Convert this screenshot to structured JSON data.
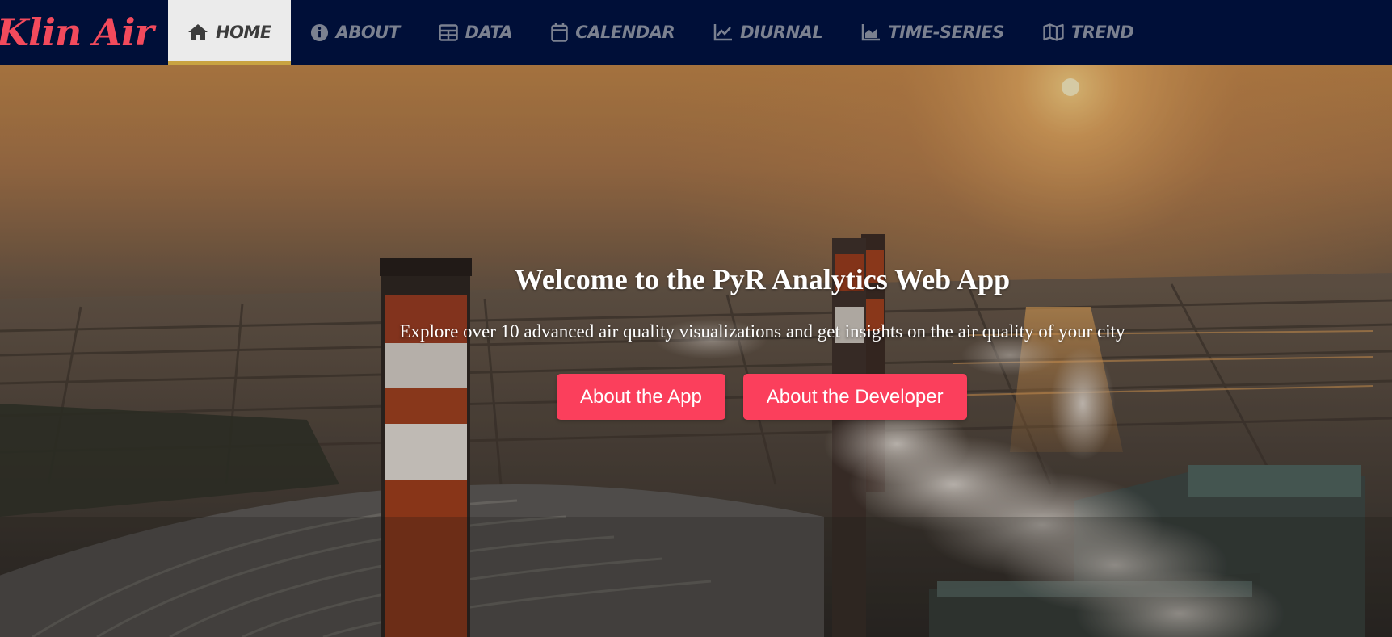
{
  "brand": {
    "name": "Klin Air",
    "color": "#f24a5c"
  },
  "nav": {
    "background": "#000f38",
    "active_index": 0,
    "items": [
      {
        "label": "HOME",
        "icon": "home-icon"
      },
      {
        "label": "ABOUT",
        "icon": "info-circle-icon"
      },
      {
        "label": "DATA",
        "icon": "table-icon"
      },
      {
        "label": "CALENDAR",
        "icon": "calendar-icon"
      },
      {
        "label": "DIURNAL",
        "icon": "line-chart-icon"
      },
      {
        "label": "TIME-SERIES",
        "icon": "area-chart-icon"
      },
      {
        "label": "TREND",
        "icon": "map-icon"
      }
    ]
  },
  "hero": {
    "title": "Welcome to the PyR Analytics Web App",
    "subtitle": "Explore over 10 advanced air quality visualizations and get insights on the air quality of your city",
    "background_image": "industrial-smokestacks-sunset",
    "buttons": [
      {
        "label": "About the App"
      },
      {
        "label": "About the Developer"
      }
    ],
    "button_color": "#fb3f5c"
  }
}
